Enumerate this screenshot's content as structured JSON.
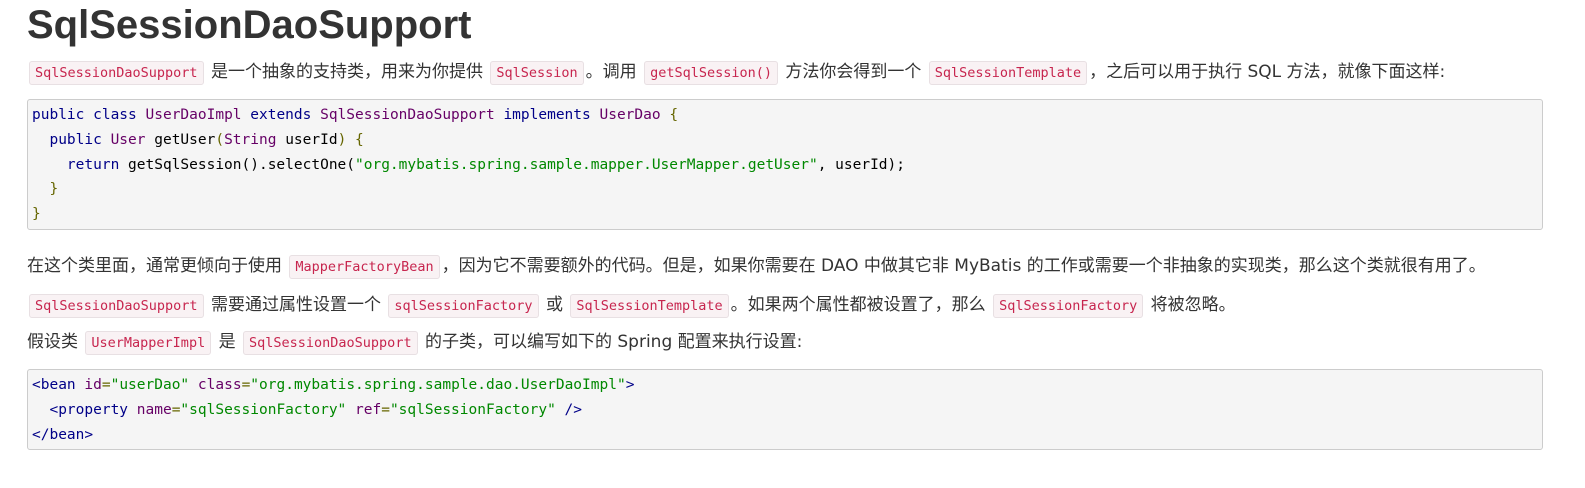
{
  "title": "SqlSessionDaoSupport",
  "para1": {
    "code_a": "SqlSessionDaoSupport",
    "text_a": " 是一个抽象的支持类，用来为你提供 ",
    "code_b": "SqlSession",
    "text_b": "。调用 ",
    "code_c": "getSqlSession()",
    "text_c": " 方法你会得到一个 ",
    "code_d": "SqlSessionTemplate",
    "text_d": "，之后可以用于执行 SQL 方法，就像下面这样:"
  },
  "code_block_1": {
    "line1": {
      "t1": "public class ",
      "t2": "UserDaoImpl",
      "t3": " extends ",
      "t4": "SqlSessionDaoSupport",
      "t5": " implements ",
      "t6": "UserDao",
      "t7": " {"
    },
    "line2": {
      "t1": "  public ",
      "t2": "User",
      "t3": " getUser",
      "t4": "(",
      "t5": "String",
      "t6": " userId",
      "t7": ") {"
    },
    "line3": {
      "t1": "    return ",
      "t2": "getSqlSession().selectOne(",
      "t3": "\"org.mybatis.spring.sample.mapper.UserMapper.getUser\"",
      "t4": ", userId);"
    },
    "line4": "  }",
    "line5": "}"
  },
  "para2": {
    "text_a": "在这个类里面，通常更倾向于使用 ",
    "code_a": "MapperFactoryBean",
    "text_b": "，因为它不需要额外的代码。但是，如果你需要在 DAO 中做其它非 MyBatis 的工作或需要一个非抽象的实现类，那么这个类就很有用了。"
  },
  "para3": {
    "code_a": "SqlSessionDaoSupport",
    "text_a": " 需要通过属性设置一个 ",
    "code_b": "sqlSessionFactory",
    "text_b": " 或 ",
    "code_c": "SqlSessionTemplate",
    "text_c": "。如果两个属性都被设置了，那么 ",
    "code_d": "SqlSessionFactory",
    "text_d": " 将被忽略。"
  },
  "para4": {
    "text_a": "假设类 ",
    "code_a": "UserMapperImpl",
    "text_b": " 是 ",
    "code_b": "SqlSessionDaoSupport",
    "text_c": " 的子类，可以编写如下的 Spring 配置来执行设置:"
  },
  "code_block_2": {
    "line1": {
      "t1": "<bean",
      "t2": " id",
      "t3": "=",
      "t4": "\"userDao\"",
      "t5": " class",
      "t6": "=",
      "t7": "\"org.mybatis.spring.sample.dao.UserDaoImpl\"",
      "t8": ">"
    },
    "line2": {
      "t1": "  <property",
      "t2": " name",
      "t3": "=",
      "t4": "\"sqlSessionFactory\"",
      "t5": " ref",
      "t6": "=",
      "t7": "\"sqlSessionFactory\"",
      "t8": " />"
    },
    "line3": "</bean>"
  }
}
